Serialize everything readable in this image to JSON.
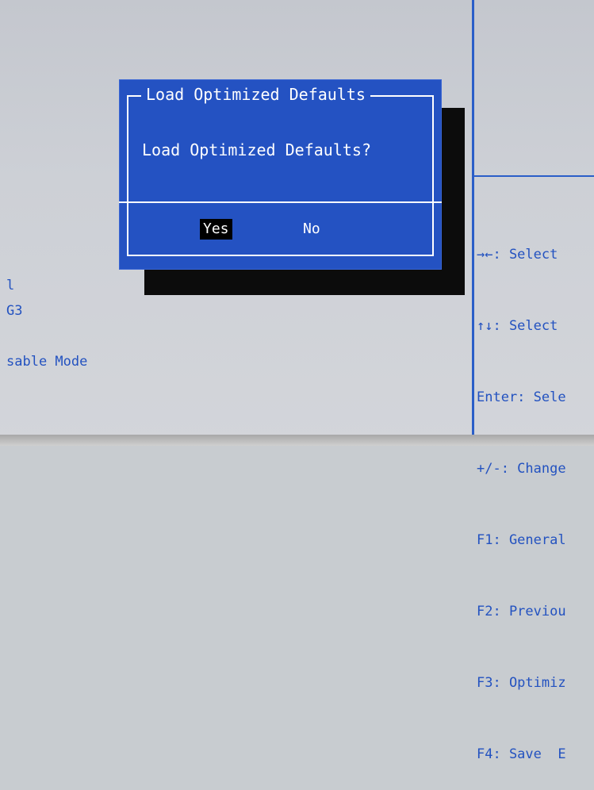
{
  "dialog": {
    "title": "Load Optimized Defaults",
    "message": "Load Optimized Defaults?",
    "buttons": {
      "yes": "Yes",
      "no": "No"
    },
    "selected": "Yes"
  },
  "left_panel": {
    "items": [
      "l",
      "G3",
      "sable Mode"
    ]
  },
  "help_panel": {
    "items": [
      "→←: Select",
      "↑↓: Select",
      "Enter: Sele",
      "+/-: Change",
      "F1: General",
      "F2: Previou",
      "F3: Optimiz",
      "F4: Save  E"
    ]
  },
  "colors": {
    "dialog_bg": "#2452c2",
    "text_blue": "#2352c0",
    "selected_bg": "#000000",
    "screen_bg": "#c8ccd0"
  }
}
